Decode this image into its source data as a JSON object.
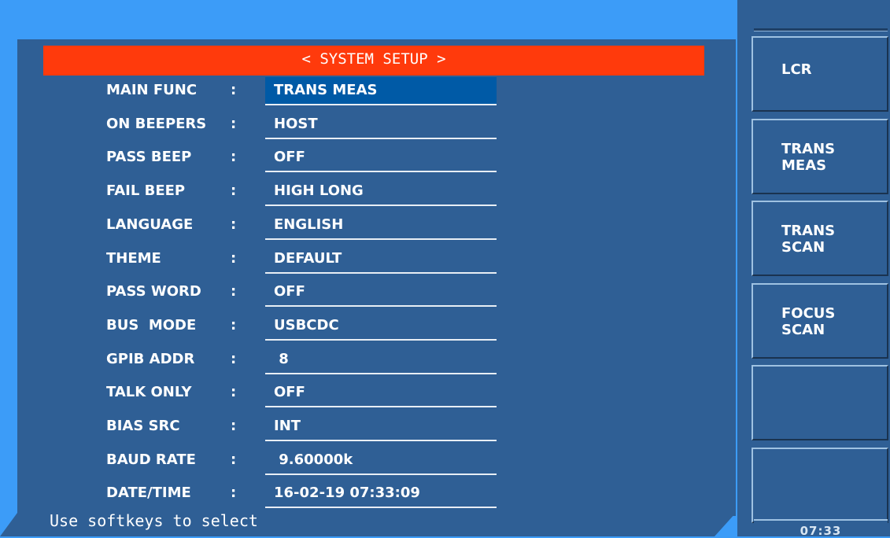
{
  "title": "< SYSTEM SETUP >",
  "rows": [
    {
      "label": "MAIN FUNC",
      "value": "TRANS MEAS",
      "selected": true
    },
    {
      "label": "ON BEEPERS",
      "value": "HOST"
    },
    {
      "label": "PASS BEEP",
      "value": "OFF"
    },
    {
      "label": "FAIL BEEP",
      "value": "HIGH LONG"
    },
    {
      "label": "LANGUAGE",
      "value": "ENGLISH"
    },
    {
      "label": "THEME",
      "value": "DEFAULT"
    },
    {
      "label": "PASS WORD",
      "value": "OFF"
    },
    {
      "label": "BUS  MODE",
      "value": "USBCDC"
    },
    {
      "label": "GPIB ADDR",
      "value": " 8"
    },
    {
      "label": "TALK ONLY",
      "value": "OFF"
    },
    {
      "label": "BIAS SRC",
      "value": "INT"
    },
    {
      "label": "BAUD RATE",
      "value": " 9.60000k"
    },
    {
      "label": "DATE/TIME",
      "value": "16-02-19 07:33:09"
    }
  ],
  "colon": ":",
  "softkeys": [
    {
      "label": "LCR"
    },
    {
      "label": "TRANS\nMEAS"
    },
    {
      "label": "TRANS\nSCAN"
    },
    {
      "label": "FOCUS\nSCAN"
    },
    {
      "label": ""
    },
    {
      "label": ""
    }
  ],
  "status": "Use softkeys to select",
  "clock": "07:33"
}
